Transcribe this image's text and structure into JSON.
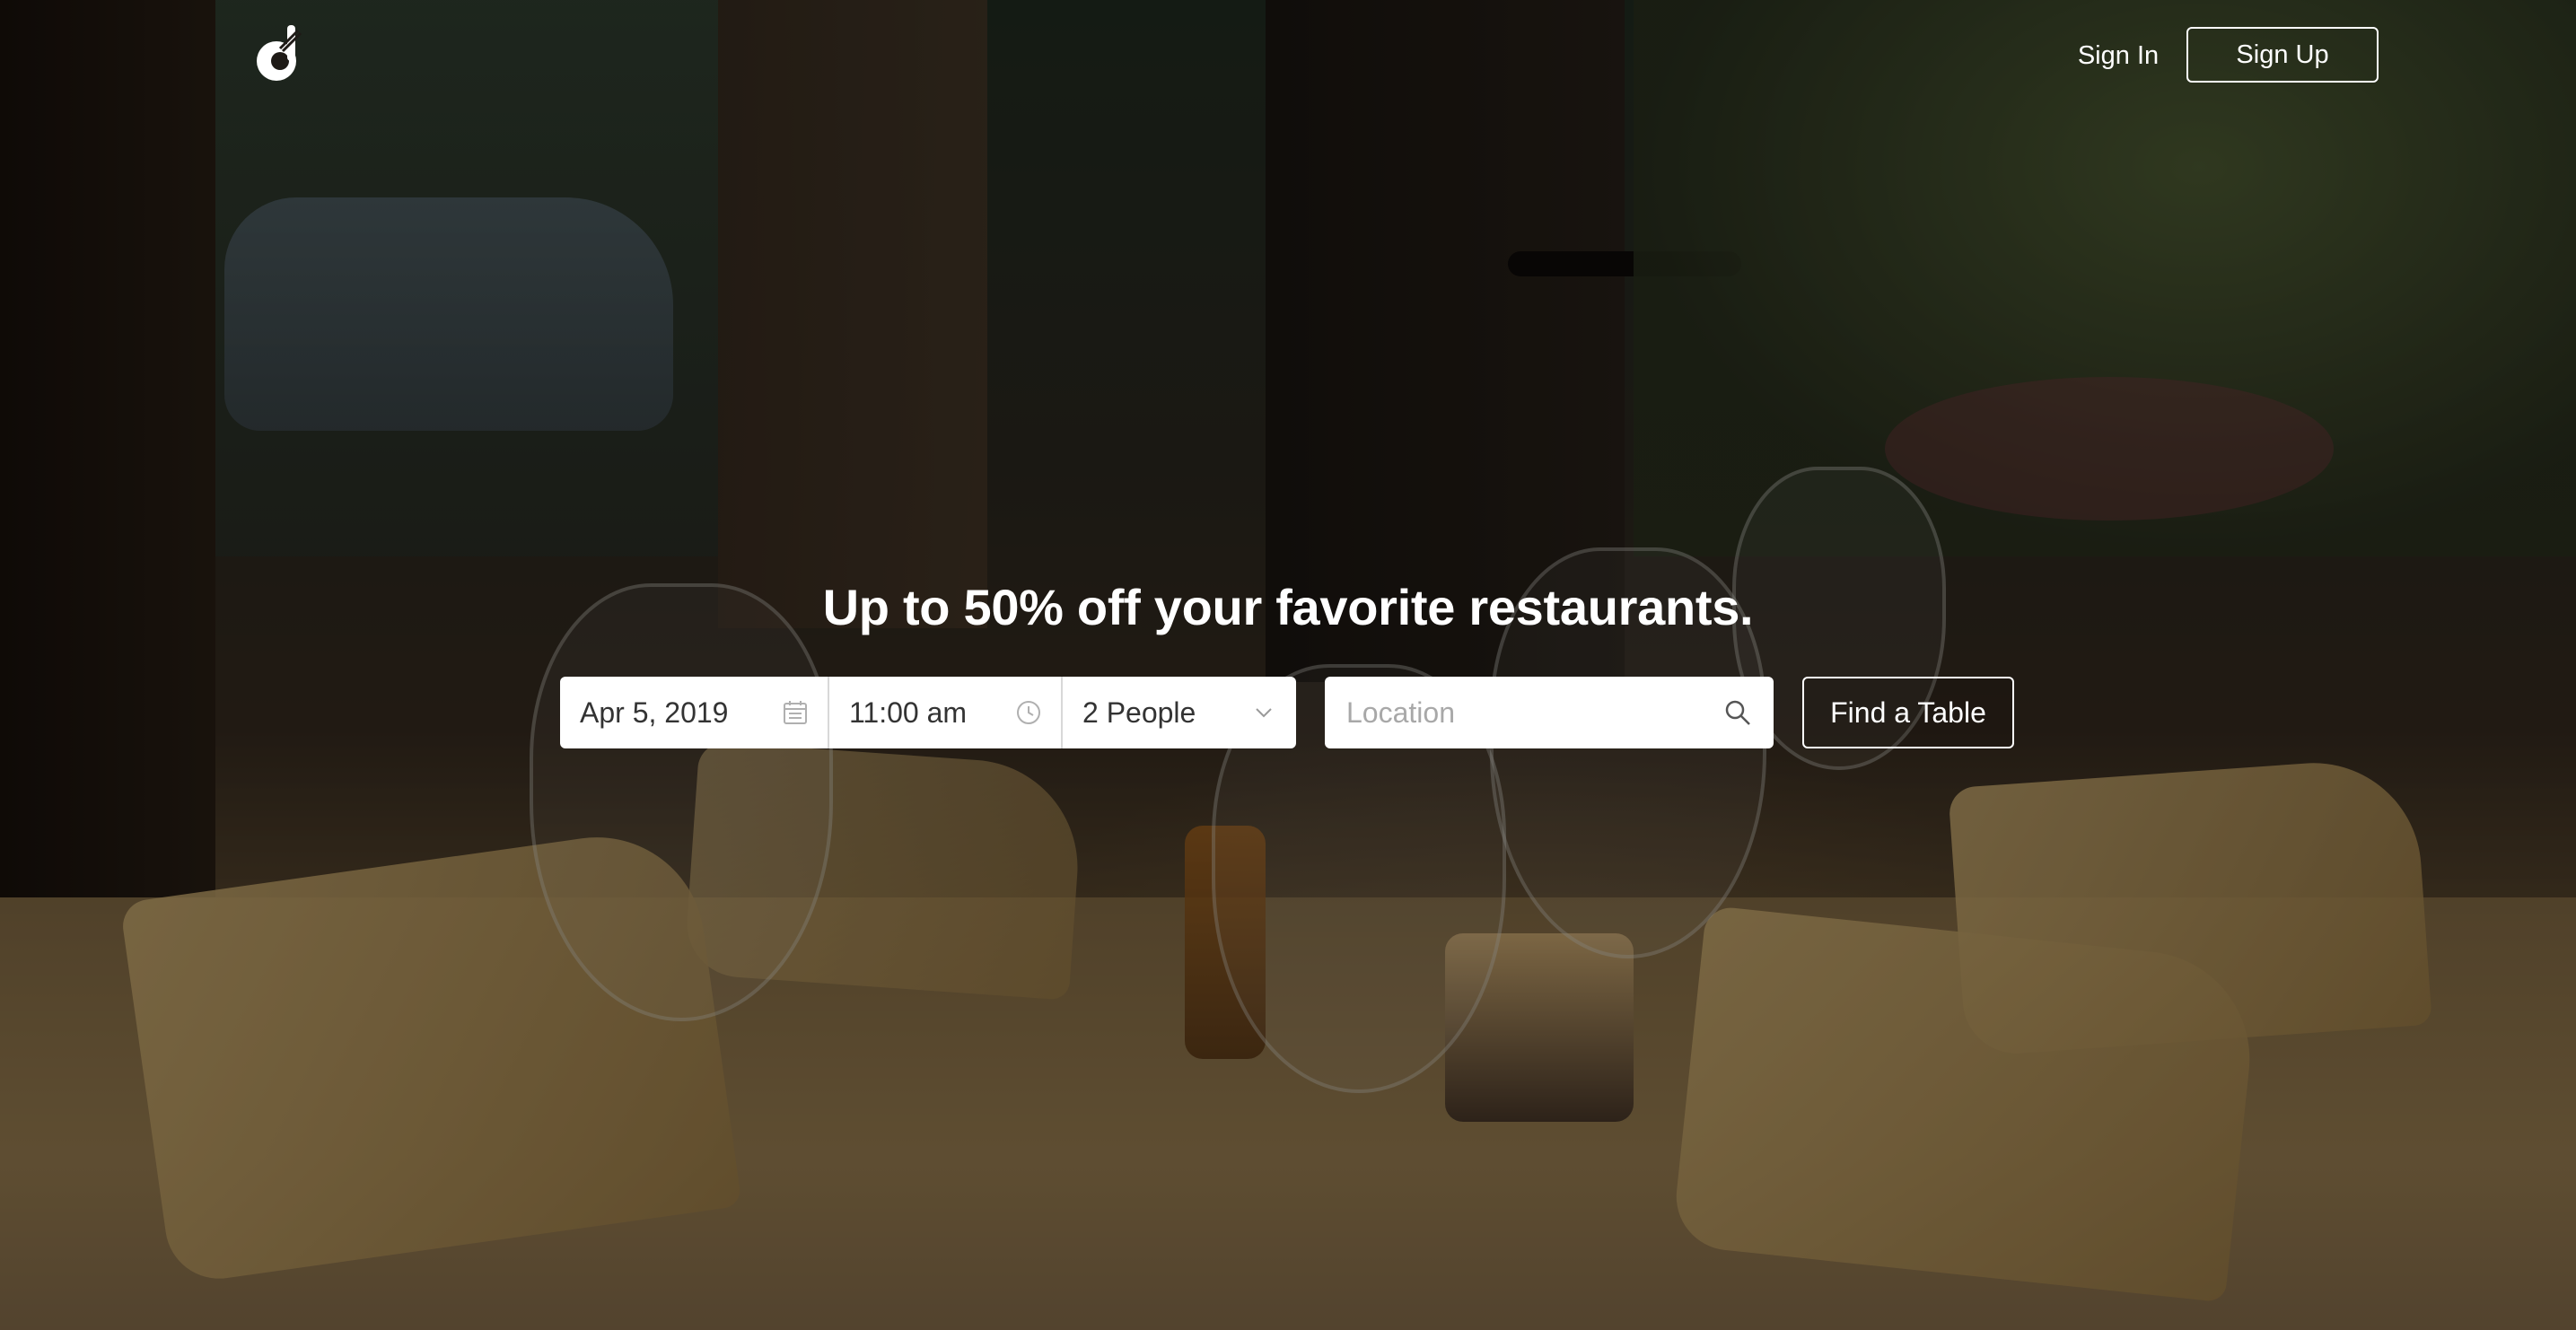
{
  "nav": {
    "sign_in_label": "Sign In",
    "sign_up_label": "Sign Up"
  },
  "hero": {
    "headline": "Up to 50% off your favorite restaurants."
  },
  "search": {
    "date_value": "Apr 5, 2019",
    "date_icon": "calendar-icon",
    "time_value": "11:00 am",
    "time_icon": "clock-icon",
    "people_value": "2 People",
    "people_icon": "chevron-down-icon",
    "location_placeholder": "Location",
    "location_value": "",
    "location_icon": "search-icon",
    "find_button_label": "Find a Table"
  },
  "colors": {
    "text_on_dark": "#ffffff",
    "input_bg": "#ffffff",
    "input_text": "#333333",
    "placeholder": "#a8a8a8"
  }
}
